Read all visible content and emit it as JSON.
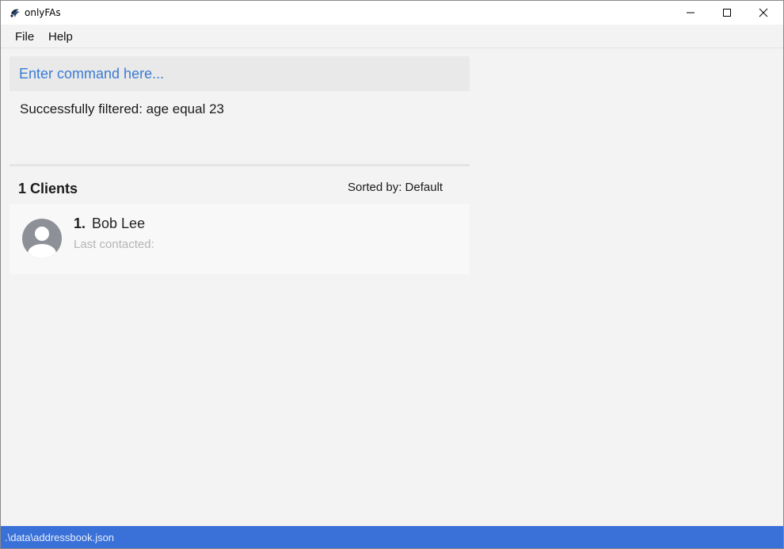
{
  "window": {
    "title": "onlyFAs",
    "app_icon": "onlyfas-logo-icon"
  },
  "menu": {
    "items": [
      "File",
      "Help"
    ]
  },
  "command": {
    "placeholder": "Enter command here...",
    "value": ""
  },
  "result": {
    "message": "Successfully filtered: age equal 23"
  },
  "client_list": {
    "count_label": "1 Clients",
    "sorted_label": "Sorted by: Default",
    "clients": [
      {
        "index": "1.",
        "name": "Bob Lee",
        "last_contacted": "Last contacted:"
      }
    ]
  },
  "status_bar": {
    "path": ".\\data\\addressbook.json"
  },
  "colors": {
    "accent": "#3a7bd5",
    "status_bar": "#3a71d8"
  }
}
